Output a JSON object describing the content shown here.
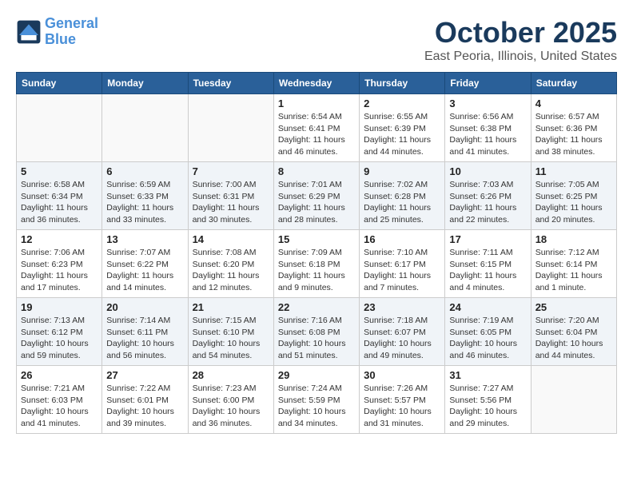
{
  "header": {
    "logo_line1": "General",
    "logo_line2": "Blue",
    "month": "October 2025",
    "location": "East Peoria, Illinois, United States"
  },
  "weekdays": [
    "Sunday",
    "Monday",
    "Tuesday",
    "Wednesday",
    "Thursday",
    "Friday",
    "Saturday"
  ],
  "weeks": [
    [
      {
        "day": "",
        "info": ""
      },
      {
        "day": "",
        "info": ""
      },
      {
        "day": "",
        "info": ""
      },
      {
        "day": "1",
        "info": "Sunrise: 6:54 AM\nSunset: 6:41 PM\nDaylight: 11 hours\nand 46 minutes."
      },
      {
        "day": "2",
        "info": "Sunrise: 6:55 AM\nSunset: 6:39 PM\nDaylight: 11 hours\nand 44 minutes."
      },
      {
        "day": "3",
        "info": "Sunrise: 6:56 AM\nSunset: 6:38 PM\nDaylight: 11 hours\nand 41 minutes."
      },
      {
        "day": "4",
        "info": "Sunrise: 6:57 AM\nSunset: 6:36 PM\nDaylight: 11 hours\nand 38 minutes."
      }
    ],
    [
      {
        "day": "5",
        "info": "Sunrise: 6:58 AM\nSunset: 6:34 PM\nDaylight: 11 hours\nand 36 minutes."
      },
      {
        "day": "6",
        "info": "Sunrise: 6:59 AM\nSunset: 6:33 PM\nDaylight: 11 hours\nand 33 minutes."
      },
      {
        "day": "7",
        "info": "Sunrise: 7:00 AM\nSunset: 6:31 PM\nDaylight: 11 hours\nand 30 minutes."
      },
      {
        "day": "8",
        "info": "Sunrise: 7:01 AM\nSunset: 6:29 PM\nDaylight: 11 hours\nand 28 minutes."
      },
      {
        "day": "9",
        "info": "Sunrise: 7:02 AM\nSunset: 6:28 PM\nDaylight: 11 hours\nand 25 minutes."
      },
      {
        "day": "10",
        "info": "Sunrise: 7:03 AM\nSunset: 6:26 PM\nDaylight: 11 hours\nand 22 minutes."
      },
      {
        "day": "11",
        "info": "Sunrise: 7:05 AM\nSunset: 6:25 PM\nDaylight: 11 hours\nand 20 minutes."
      }
    ],
    [
      {
        "day": "12",
        "info": "Sunrise: 7:06 AM\nSunset: 6:23 PM\nDaylight: 11 hours\nand 17 minutes."
      },
      {
        "day": "13",
        "info": "Sunrise: 7:07 AM\nSunset: 6:22 PM\nDaylight: 11 hours\nand 14 minutes."
      },
      {
        "day": "14",
        "info": "Sunrise: 7:08 AM\nSunset: 6:20 PM\nDaylight: 11 hours\nand 12 minutes."
      },
      {
        "day": "15",
        "info": "Sunrise: 7:09 AM\nSunset: 6:18 PM\nDaylight: 11 hours\nand 9 minutes."
      },
      {
        "day": "16",
        "info": "Sunrise: 7:10 AM\nSunset: 6:17 PM\nDaylight: 11 hours\nand 7 minutes."
      },
      {
        "day": "17",
        "info": "Sunrise: 7:11 AM\nSunset: 6:15 PM\nDaylight: 11 hours\nand 4 minutes."
      },
      {
        "day": "18",
        "info": "Sunrise: 7:12 AM\nSunset: 6:14 PM\nDaylight: 11 hours\nand 1 minute."
      }
    ],
    [
      {
        "day": "19",
        "info": "Sunrise: 7:13 AM\nSunset: 6:12 PM\nDaylight: 10 hours\nand 59 minutes."
      },
      {
        "day": "20",
        "info": "Sunrise: 7:14 AM\nSunset: 6:11 PM\nDaylight: 10 hours\nand 56 minutes."
      },
      {
        "day": "21",
        "info": "Sunrise: 7:15 AM\nSunset: 6:10 PM\nDaylight: 10 hours\nand 54 minutes."
      },
      {
        "day": "22",
        "info": "Sunrise: 7:16 AM\nSunset: 6:08 PM\nDaylight: 10 hours\nand 51 minutes."
      },
      {
        "day": "23",
        "info": "Sunrise: 7:18 AM\nSunset: 6:07 PM\nDaylight: 10 hours\nand 49 minutes."
      },
      {
        "day": "24",
        "info": "Sunrise: 7:19 AM\nSunset: 6:05 PM\nDaylight: 10 hours\nand 46 minutes."
      },
      {
        "day": "25",
        "info": "Sunrise: 7:20 AM\nSunset: 6:04 PM\nDaylight: 10 hours\nand 44 minutes."
      }
    ],
    [
      {
        "day": "26",
        "info": "Sunrise: 7:21 AM\nSunset: 6:03 PM\nDaylight: 10 hours\nand 41 minutes."
      },
      {
        "day": "27",
        "info": "Sunrise: 7:22 AM\nSunset: 6:01 PM\nDaylight: 10 hours\nand 39 minutes."
      },
      {
        "day": "28",
        "info": "Sunrise: 7:23 AM\nSunset: 6:00 PM\nDaylight: 10 hours\nand 36 minutes."
      },
      {
        "day": "29",
        "info": "Sunrise: 7:24 AM\nSunset: 5:59 PM\nDaylight: 10 hours\nand 34 minutes."
      },
      {
        "day": "30",
        "info": "Sunrise: 7:26 AM\nSunset: 5:57 PM\nDaylight: 10 hours\nand 31 minutes."
      },
      {
        "day": "31",
        "info": "Sunrise: 7:27 AM\nSunset: 5:56 PM\nDaylight: 10 hours\nand 29 minutes."
      },
      {
        "day": "",
        "info": ""
      }
    ]
  ]
}
